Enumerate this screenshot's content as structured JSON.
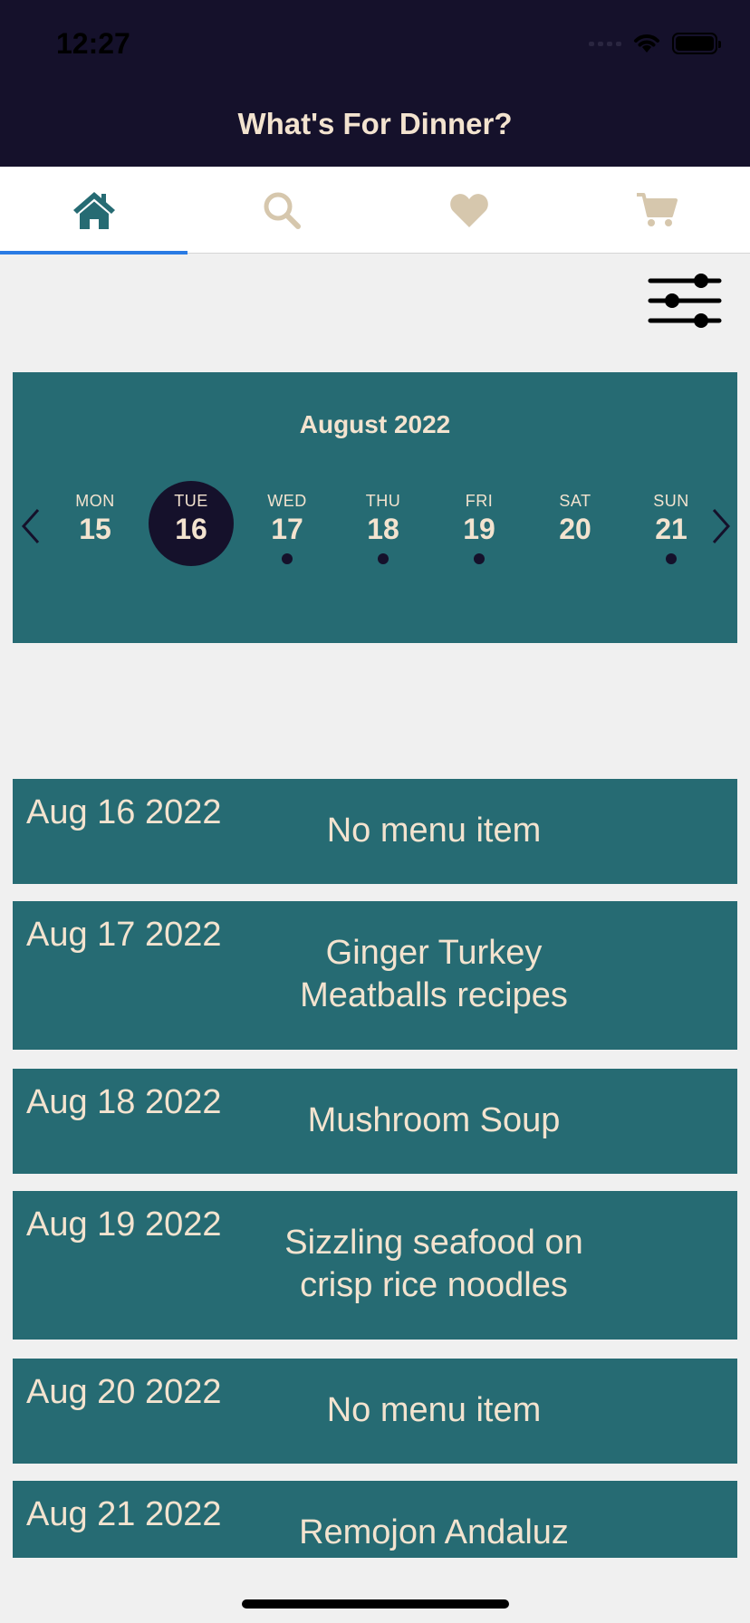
{
  "status_bar": {
    "time": "12:27"
  },
  "app": {
    "title": "What's For Dinner?"
  },
  "tabs": [
    {
      "icon": "home-icon",
      "active": true
    },
    {
      "icon": "search-icon",
      "active": false
    },
    {
      "icon": "heart-icon",
      "active": false
    },
    {
      "icon": "cart-icon",
      "active": false
    }
  ],
  "colors": {
    "header_bg": "#15112b",
    "accent_text": "#f3e3cf",
    "teal": "#266b73",
    "tab_active_indicator": "#2a7be4",
    "tab_icon_inactive": "#d6c7ad"
  },
  "calendar": {
    "month": "August 2022",
    "days": [
      {
        "dow": "MON",
        "num": "15",
        "selected": false,
        "has_item": false
      },
      {
        "dow": "TUE",
        "num": "16",
        "selected": true,
        "has_item": false
      },
      {
        "dow": "WED",
        "num": "17",
        "selected": false,
        "has_item": true
      },
      {
        "dow": "THU",
        "num": "18",
        "selected": false,
        "has_item": true
      },
      {
        "dow": "FRI",
        "num": "19",
        "selected": false,
        "has_item": true
      },
      {
        "dow": "SAT",
        "num": "20",
        "selected": false,
        "has_item": false
      },
      {
        "dow": "SUN",
        "num": "21",
        "selected": false,
        "has_item": true
      }
    ]
  },
  "menu": [
    {
      "date": "Aug 16 2022",
      "name_lines": [
        "No menu item"
      ]
    },
    {
      "date": "Aug 17 2022",
      "name_lines": [
        "Ginger Turkey",
        "Meatballs recipes"
      ]
    },
    {
      "date": "Aug 18 2022",
      "name_lines": [
        "Mushroom Soup"
      ]
    },
    {
      "date": "Aug 19 2022",
      "name_lines": [
        "Sizzling seafood on",
        "crisp rice noodles"
      ]
    },
    {
      "date": "Aug 20 2022",
      "name_lines": [
        "No menu item"
      ]
    },
    {
      "date": "Aug 21 2022",
      "name_lines": [
        "Remojon Andaluz"
      ]
    }
  ]
}
